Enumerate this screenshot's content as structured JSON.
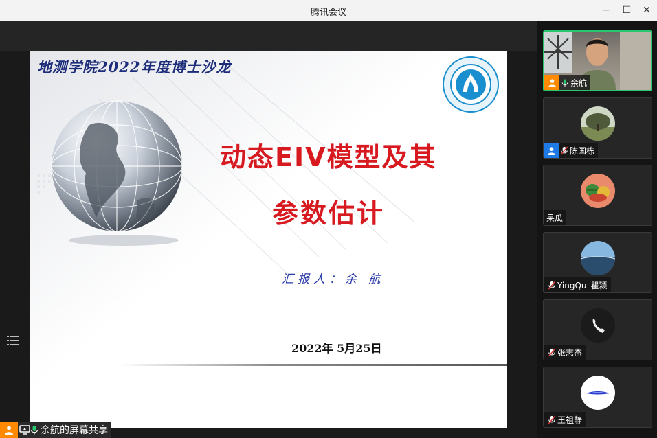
{
  "window": {
    "title": "腾讯会议",
    "minimize": "−",
    "maximize": "☐",
    "close": "✕"
  },
  "slide": {
    "header": "地测学院2022年度博士沙龙",
    "title_line1": "动态EIV模型及其",
    "title_line2": "参数估计",
    "reporter": "汇报人：余 航",
    "date": "2022年 5月25日"
  },
  "share_bar": {
    "label": "余航的屏幕共享"
  },
  "participants": [
    {
      "name": "余航",
      "avatar": "user-icon",
      "mic": "on",
      "active": true
    },
    {
      "name": "陈国栋",
      "avatar": "user-icon",
      "mic": "muted",
      "active": false
    },
    {
      "name": "呆瓜",
      "avatar": "none",
      "mic": "none",
      "active": false
    },
    {
      "name": "YingQu_瞿颍",
      "avatar": "none",
      "mic": "muted",
      "active": false
    },
    {
      "name": "张志杰",
      "avatar": "none",
      "mic": "muted",
      "active": false
    },
    {
      "name": "王祖静",
      "avatar": "none",
      "mic": "muted",
      "active": false
    }
  ],
  "colors": {
    "accent_green": "#28c76f",
    "orange": "#ff8a00",
    "title_red": "#d71920",
    "header_blue": "#1d2d7a"
  }
}
